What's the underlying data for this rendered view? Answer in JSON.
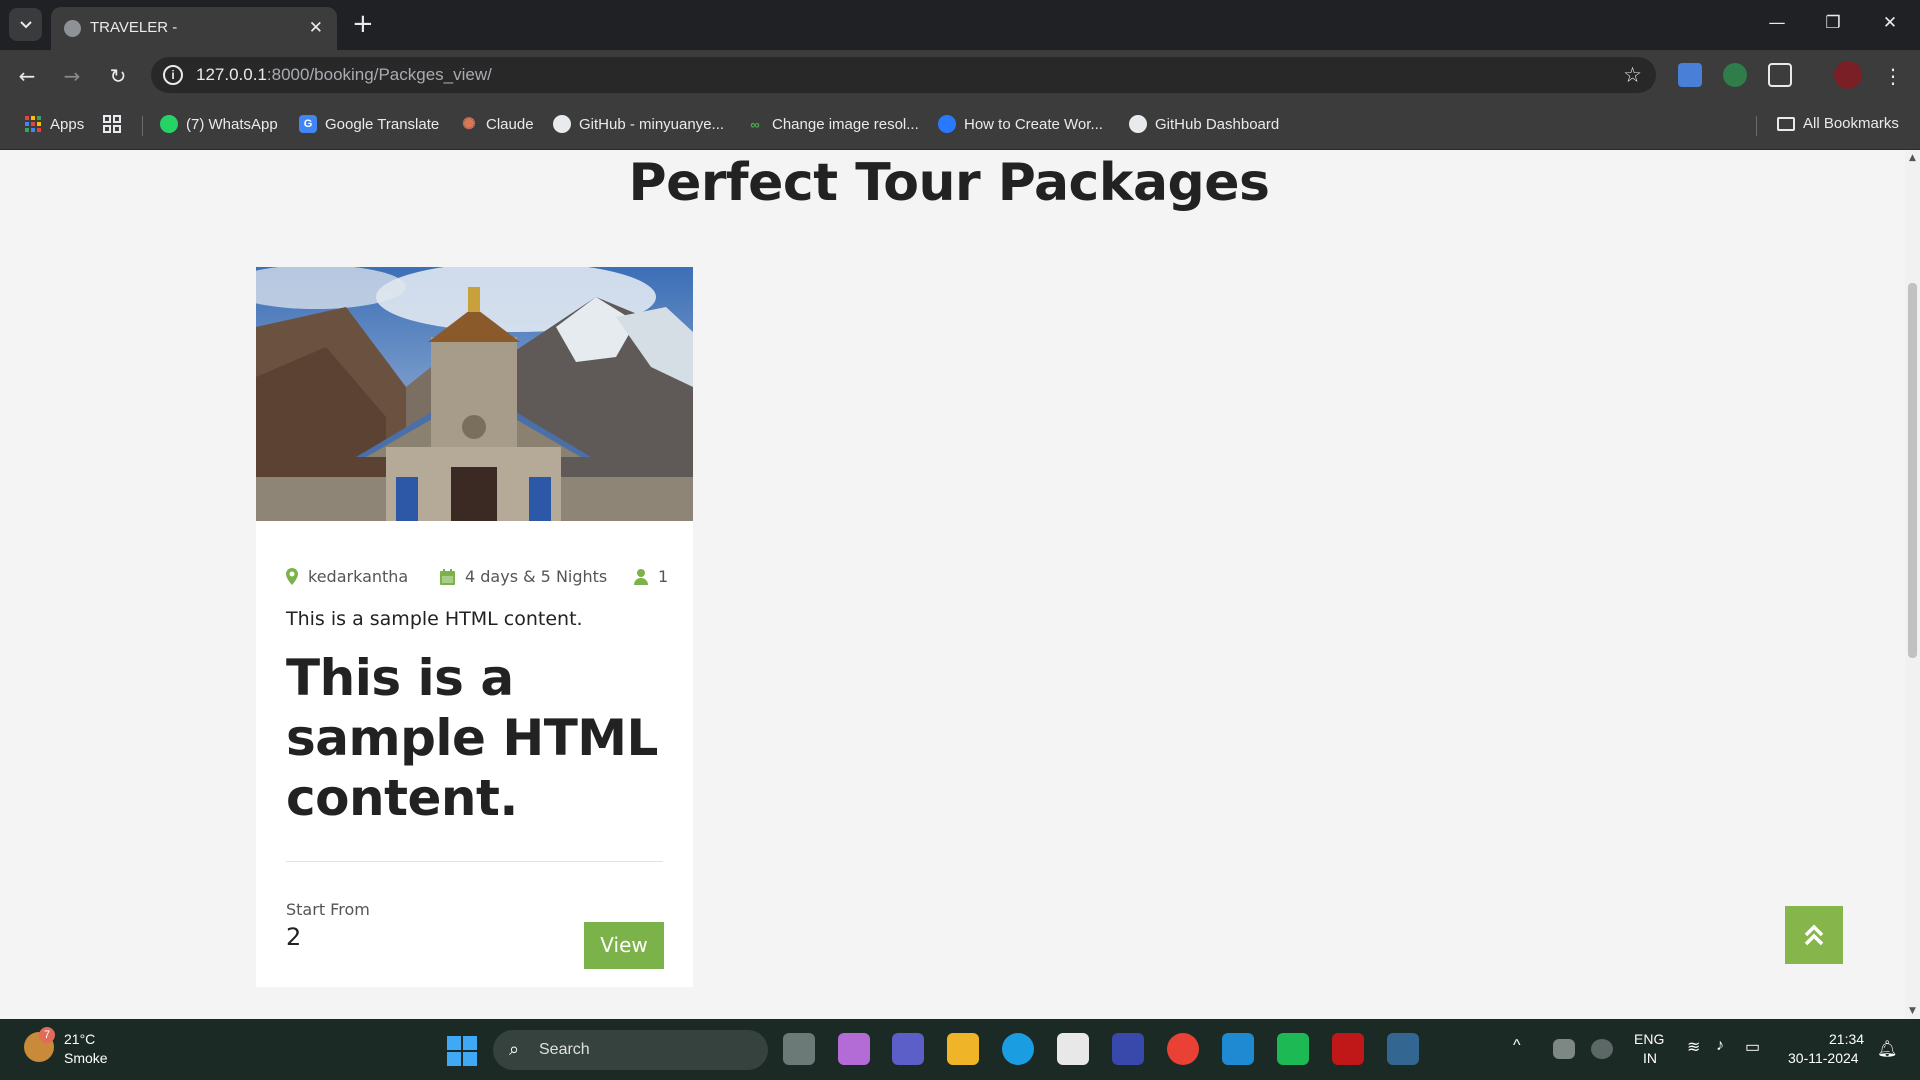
{
  "browser": {
    "tab_title": "TRAVELER -",
    "url_host": "127.0.0.1",
    "url_rest": ":8000/booking/Packges_view/",
    "bookmarks": [
      {
        "label": "Apps",
        "color": "#4285f4"
      },
      {
        "label": "(7) WhatsApp",
        "color": "#25d366"
      },
      {
        "label": "Google Translate",
        "color": "#4285f4"
      },
      {
        "label": "Claude",
        "color": "#d97757"
      },
      {
        "label": "GitHub - minyuanye...",
        "color": "#555555"
      },
      {
        "label": "Change image resol...",
        "color": "#4caf50"
      },
      {
        "label": "How to Create Wor...",
        "color": "#2979ff"
      },
      {
        "label": "GitHub Dashboard",
        "color": "#555555"
      }
    ],
    "all_bookmarks": "All Bookmarks"
  },
  "page": {
    "heading": "Perfect Tour Packages",
    "package": {
      "location": "kedarkantha",
      "duration": "4 days & 5 Nights",
      "persons": "1",
      "short_description": "This is a sample HTML content.",
      "title": "This is a sample HTML content.",
      "price_label": "Start From",
      "price": "2",
      "view_label": "View"
    },
    "accent_color": "#7cb24a"
  },
  "taskbar": {
    "weather_badge": "7",
    "temperature": "21°C",
    "weather": "Smoke",
    "search_placeholder": "Search",
    "language_1": "ENG",
    "language_2": "IN",
    "time": "21:34",
    "date": "30-11-2024"
  }
}
